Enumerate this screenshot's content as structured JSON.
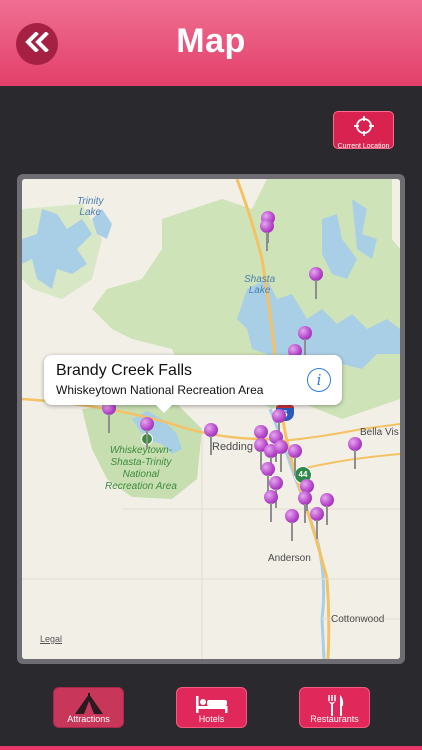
{
  "header": {
    "title": "Map",
    "back_icon": "double-chevron-left-icon"
  },
  "current_location": {
    "label": "Current Location",
    "icon": "crosshair-icon"
  },
  "map": {
    "labels": {
      "trinity_lake": "Trinity\nLake",
      "shasta_lake": "Shasta\nLake",
      "whiskeytown_area": "Whiskeytown-\nShasta-Trinity\nNational\nRecreation Area",
      "redding": "Redding",
      "bella_vista": "Bella Vis",
      "anderson": "Anderson",
      "cottonwood": "Cottonwood",
      "legal": "Legal",
      "i5_shield": "5",
      "hwy44_shield": "44"
    },
    "callout": {
      "title": "Brandy Creek Falls",
      "subtitle": "Whiskeytown National Recreation Area"
    },
    "pin_color": "#b03fc6"
  },
  "tabs": [
    {
      "label": "Attractions",
      "icon": "tent-icon",
      "active": true
    },
    {
      "label": "Hotels",
      "icon": "bed-icon",
      "active": false
    },
    {
      "label": "Restaurants",
      "icon": "fork-knife-icon",
      "active": false
    }
  ],
  "colors": {
    "accent": "#e23f6a",
    "background": "#2a292e"
  }
}
